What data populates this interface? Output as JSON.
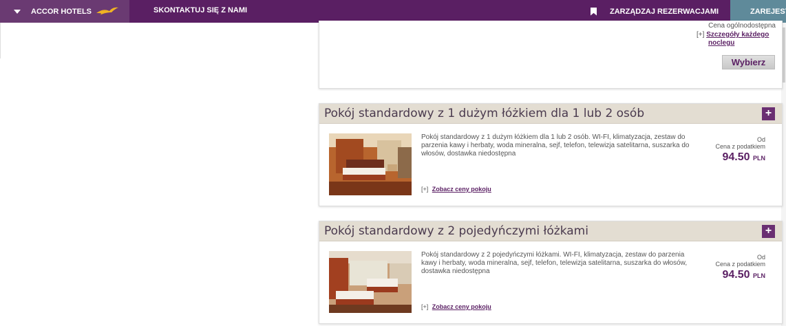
{
  "topbar": {
    "brand": "ACCOR HOTELS",
    "contact": "SKONTAKTUJ SIĘ Z NAMI",
    "manage": "ZARZĄDZAJ REZERWACJAMI",
    "register": "ZAREJESTRUJ"
  },
  "top_card": {
    "availability": "Cena ogólnodostępna",
    "details_prefix": "[+]",
    "details_link_line1": "Szczegóły każdego",
    "details_link_line2": "noclegu",
    "select": "Wybierz"
  },
  "rooms": [
    {
      "title": "Pokój standardowy z 1 dużym łóżkiem dla 1 lub 2 osób",
      "description": "Pokój standardowy z 1 dużym łóżkiem dla 1 lub 2 osób. WI-FI, klimatyzacja, zestaw do parzenia kawy i herbaty, woda mineralna, sejf, telefon, telewizja satelitarna, suszarka do włosów, dostawka niedostępna",
      "prices_prefix": "[+]",
      "prices_link": "Zobacz ceny pokoju",
      "from": "Od",
      "tax_note": "Cena z podatkiem",
      "amount": "94.50",
      "currency": "PLN"
    },
    {
      "title": "Pokój standardowy z 2 pojedyńczymi łóżkami",
      "description": "Pokój standardowy z 2 pojedyńczymi łóżkami. WI-FI, klimatyzacja, zestaw do parzenia kawy i herbaty, woda mineralna, sejf, telefon, telewizja satelitarna, suszarka do włosów, dostawka niedostępna",
      "prices_prefix": "[+]",
      "prices_link": "Zobacz ceny pokoju",
      "from": "Od",
      "tax_note": "Cena z podatkiem",
      "amount": "94.50",
      "currency": "PLN"
    }
  ],
  "colors": {
    "brand_purple": "#5a1f63",
    "header_beige": "#e3ddd2",
    "register_teal": "#5f8a9a",
    "bird_gold": "#f0b323"
  }
}
